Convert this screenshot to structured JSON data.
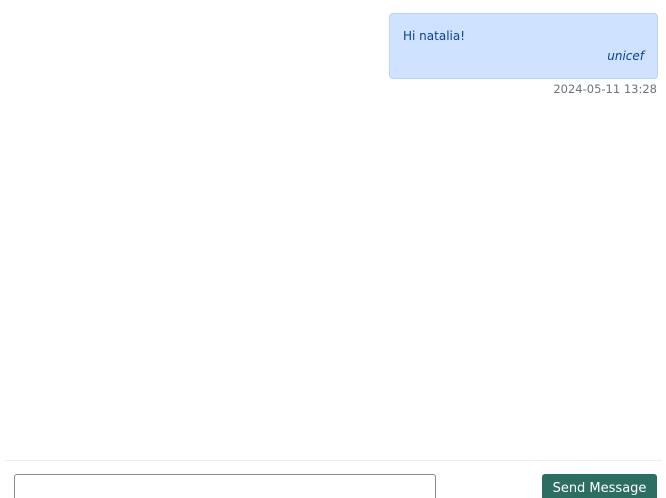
{
  "messages": [
    {
      "text": "Hi natalia!",
      "sender": "unicef",
      "timestamp": "2024-05-11 13:28"
    }
  ],
  "composer": {
    "input_value": "",
    "input_placeholder": "",
    "send_label": "Send Message"
  },
  "colors": {
    "bubble_background": "#cfe2ff",
    "bubble_text": "#084298",
    "send_button": "#2d6e63"
  }
}
